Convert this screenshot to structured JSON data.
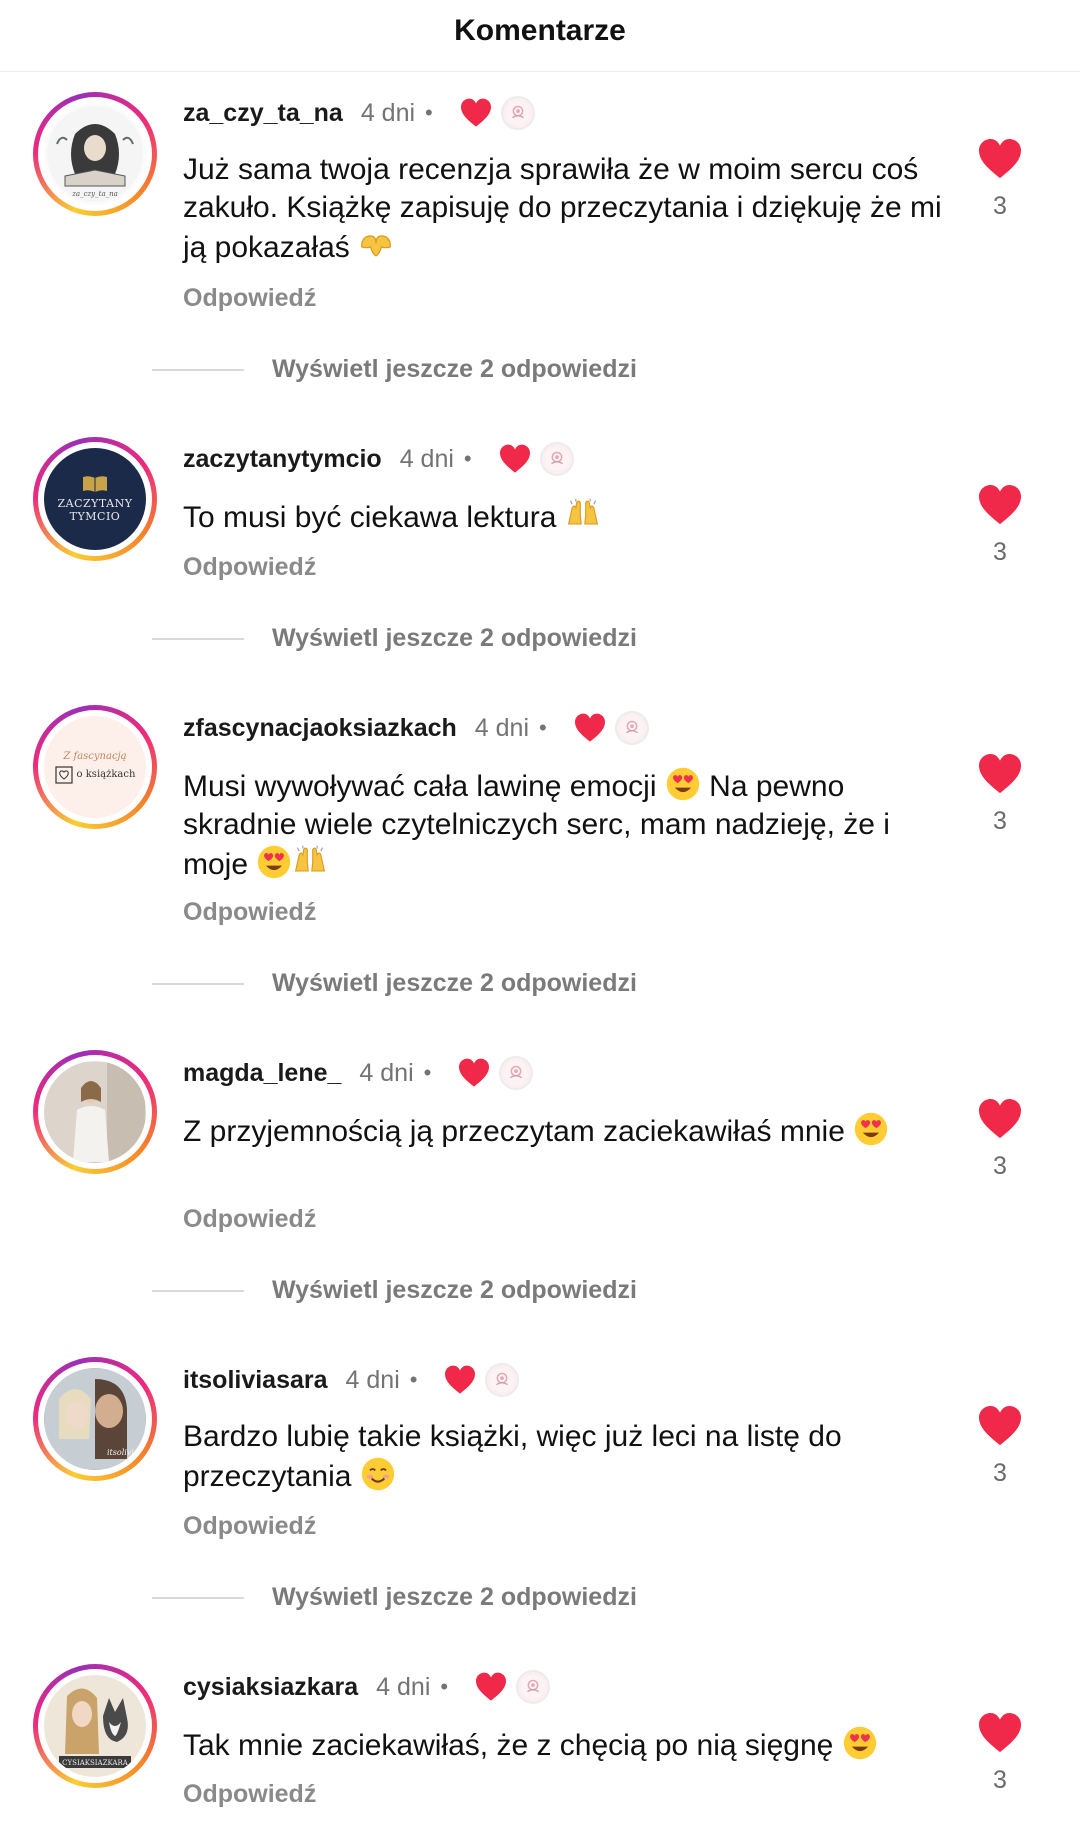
{
  "header": {
    "title": "Komentarze"
  },
  "colors": {
    "like": "#f02849",
    "muted": "#737373"
  },
  "comments": [
    {
      "username": "za_czy_ta_na",
      "time": "4 dni",
      "text": "Już sama twoja recenzja sprawiła że w moim sercu coś zakuło. Książkę zapisuję do przeczytania i dziękuję że mi ją pokazałaś",
      "emoji": [
        "heart-hands"
      ],
      "reply": "Odpowiedź",
      "likes": "3",
      "view_more": "Wyświetl jeszcze 2 odpowiedzi",
      "avatar_icon": "woman-reading-illustration"
    },
    {
      "username": "zaczytanytymcio",
      "time": "4 dni",
      "text": "To musi być ciekawa lektura",
      "emoji": [
        "raised-hands"
      ],
      "reply": "Odpowiedź",
      "likes": "3",
      "view_more": "Wyświetl jeszcze 2 odpowiedzi",
      "avatar_text": [
        "ZACZYTANY",
        "TYMCIO"
      ]
    },
    {
      "username": "zfascynacjaoksiazkach",
      "time": "4 dni",
      "text": "Musi wywoływać cała lawinę emocji",
      "text2": "Na pewno skradnie wiele czytelniczych serc, mam nadzieję, że i moje",
      "emoji": [
        "heart-eyes",
        "heart-eyes",
        "raised-hands"
      ],
      "reply": "Odpowiedź",
      "likes": "3",
      "view_more": "Wyświetl jeszcze 2 odpowiedzi",
      "avatar_text": [
        "Z fascynacją",
        "o książkach"
      ]
    },
    {
      "username": "magda_lene_",
      "time": "4 dni",
      "text": "Z przyjemnością ją przeczytam zaciekawiłaś mnie",
      "emoji": [
        "heart-eyes"
      ],
      "reply": "Odpowiedź",
      "likes": "3",
      "view_more": "Wyświetl jeszcze 2 odpowiedzi",
      "avatar_icon": "woman-photo"
    },
    {
      "username": "itsoliviasara",
      "time": "4 dni",
      "text": "Bardzo lubię takie książki, więc już leci na listę do przeczytania",
      "emoji": [
        "smiling-face"
      ],
      "reply": "Odpowiedź",
      "likes": "3",
      "view_more": "Wyświetl jeszcze 2 odpowiedzi",
      "avatar_icon": "couple-photo"
    },
    {
      "username": "cysiaksiazkara",
      "time": "4 dni",
      "text": "Tak mnie zaciekawiłaś, że z chęcią po nią sięgnę",
      "emoji": [
        "heart-eyes"
      ],
      "reply": "Odpowiedź",
      "likes": "3",
      "avatar_icon": "girl-with-husky-illustration"
    }
  ]
}
